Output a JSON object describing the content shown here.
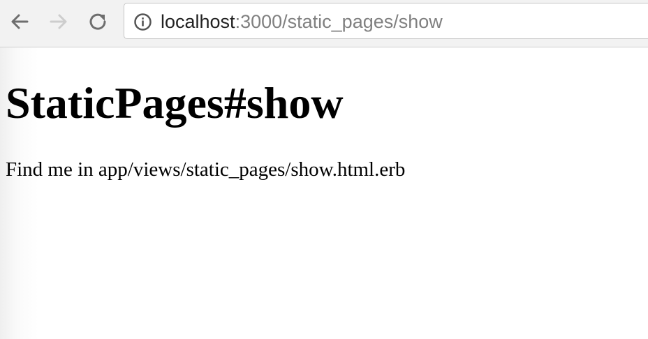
{
  "toolbar": {
    "back": {
      "icon": "back-arrow-icon",
      "enabled": true
    },
    "forward": {
      "icon": "forward-arrow-icon",
      "enabled": false
    },
    "reload": {
      "icon": "reload-icon"
    },
    "address": {
      "info_icon": "info-circle-icon",
      "host": "localhost",
      "rest": ":3000/static_pages/show"
    }
  },
  "page": {
    "title": "StaticPages#show",
    "body": "Find me in app/views/static_pages/show.html.erb"
  }
}
